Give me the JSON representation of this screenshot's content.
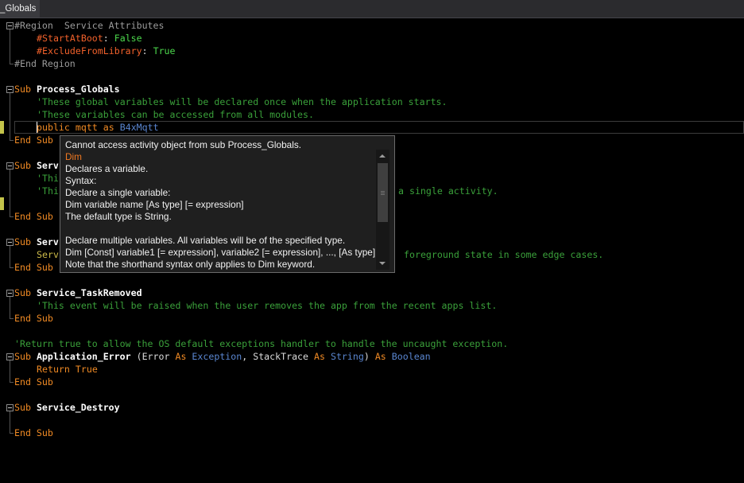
{
  "tab": {
    "title": "_Globals"
  },
  "theme": {
    "editor_bg": "#000000",
    "keyword": "#f08a24",
    "sub_name": "#ffffff",
    "comment": "#3aa03a",
    "directive": "#f2612b",
    "attr_value": "#4cd84c",
    "region": "#9b9b9b",
    "type": "#5a86d0",
    "identifier": "#dcdcdc",
    "object": "#cdbb4a",
    "modified_marker": "#c4c44a",
    "tooltip_bg": "#1f1f1f",
    "tooltip_keyword": "#f07820"
  },
  "editor": {
    "lines": [
      [
        "#Region",
        "Service Attributes"
      ],
      [
        "#StartAtBoot",
        ":",
        "False"
      ],
      [
        "#ExcludeFromLibrary",
        ":",
        "True"
      ],
      [
        "#End Region"
      ],
      [],
      [
        "Sub",
        "Process_Globals"
      ],
      [
        "'These global variables will be declared once when the application starts."
      ],
      [
        "'These variables can be accessed from all modules."
      ],
      [
        "public",
        "mqtt",
        "as",
        "B4xMqtt"
      ],
      [
        "End Sub"
      ],
      [],
      [
        "Sub",
        "Serv"
      ],
      [
        "'Thi"
      ],
      [
        "'Thi",
        "a single activity."
      ],
      [],
      [
        "End Sub"
      ],
      [],
      [
        "Sub",
        "Serv"
      ],
      [
        "Serv",
        "foreground state in some edge cases."
      ],
      [
        "End Sub"
      ],
      [],
      [
        "Sub",
        "Service_TaskRemoved"
      ],
      [
        "'This event will be raised when the user removes the app from the recent apps list."
      ],
      [
        "End Sub"
      ],
      [],
      [
        "'Return true to allow the OS default exceptions handler to handle the uncaught exception."
      ],
      [
        "Sub",
        "Application_Error",
        "(Error",
        "As",
        "Exception",
        ",",
        "StackTrace",
        "As",
        "String",
        ")",
        "As",
        "Boolean"
      ],
      [
        "Return",
        "True"
      ],
      [
        "End Sub"
      ],
      [],
      [
        "Sub",
        "Service_Destroy"
      ],
      [],
      [
        "End Sub"
      ]
    ]
  },
  "tooltip": {
    "lines": [
      "Cannot access activity object from sub Process_Globals.",
      "Dim",
      "Declares a variable.",
      "Syntax:",
      "Declare a single variable:",
      "Dim variable name [As type] [= expression]",
      "The default type is String.",
      "Declare multiple variables. All variables will be of the specified type.",
      "Dim [Const] variable1 [= expression], variable2 [= expression], ..., [As type]",
      "Note that the shorthand syntax only applies to Dim keyword."
    ],
    "scrollbar": {
      "offset_fraction": 0,
      "visible_fraction": 0.63
    }
  }
}
